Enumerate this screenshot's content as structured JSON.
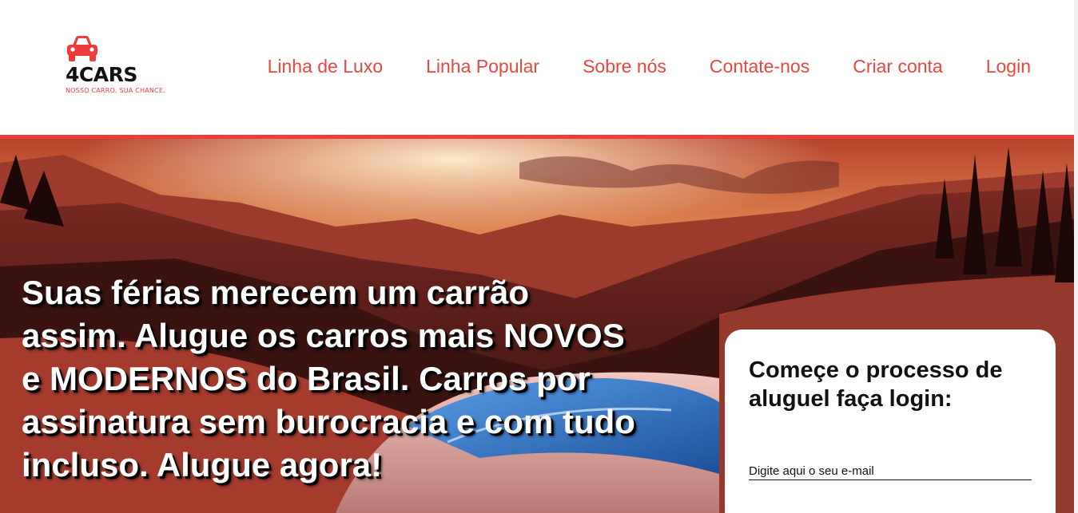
{
  "brand": {
    "name": "4CARS",
    "tagline": "NOSSO CARRO, SUA CHANCE.",
    "logo_icon": "car-icon"
  },
  "nav": {
    "items": [
      {
        "label": "Linha de Luxo"
      },
      {
        "label": "Linha Popular"
      },
      {
        "label": "Sobre nós"
      },
      {
        "label": "Contate-nos"
      },
      {
        "label": "Criar conta"
      },
      {
        "label": "Login"
      }
    ]
  },
  "hero": {
    "headline": "Suas férias merecem um carrão assim. Alugue os carros mais NOVOS e MODERNOS do Brasil. Carros por assinatura sem burocracia e com tudo incluso. Alugue agora!"
  },
  "login": {
    "title": "Começe o processo de aluguel faça login:",
    "email_placeholder": "Digite aqui o seu e-mail"
  },
  "colors": {
    "accent": "#ee3b3b",
    "nav_link": "#e8473f",
    "text": "#111111"
  }
}
